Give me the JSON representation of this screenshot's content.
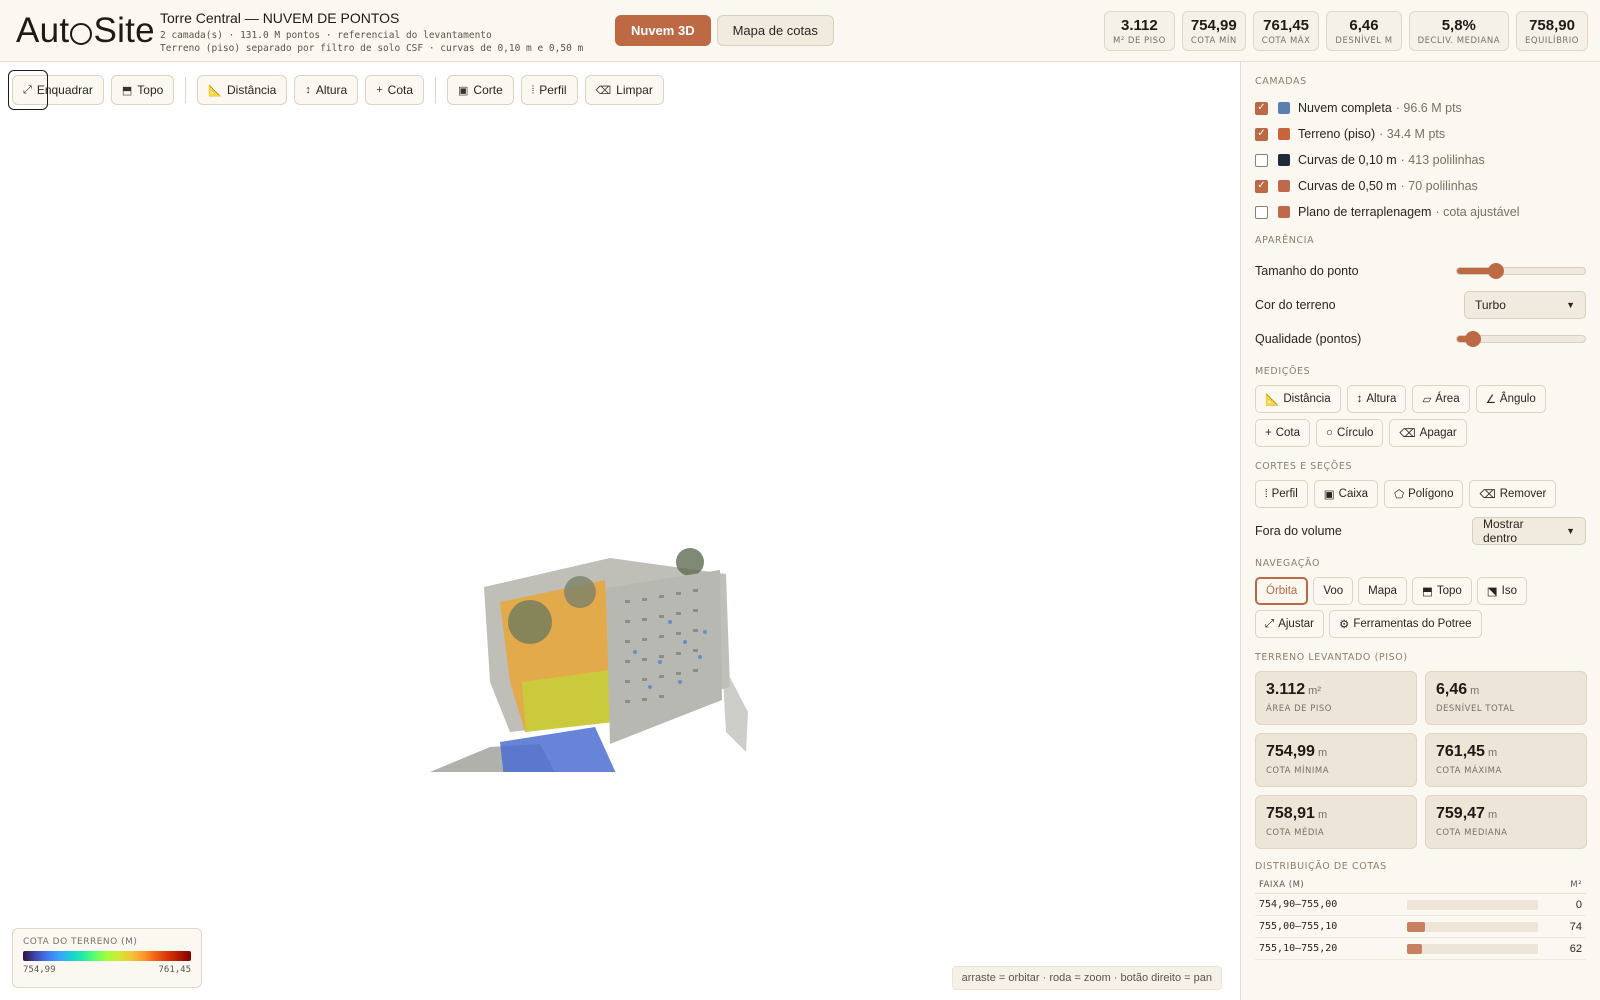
{
  "app": {
    "logo_left": "Aut",
    "logo_right": "Site",
    "project_title": "Torre Central — NUVEM DE PONTOS",
    "project_sub1": "2 camada(s) · 131.0 M pontos · referencial do levantamento",
    "project_sub2": "Terreno (piso) separado por filtro de solo CSF · curvas de 0,10 m e 0,50 m"
  },
  "mode_tabs": [
    {
      "label": "Nuvem 3D",
      "active": true
    },
    {
      "label": "Mapa de cotas",
      "active": false
    }
  ],
  "stats": [
    {
      "value": "3.112",
      "label": "M² DE PISO"
    },
    {
      "value": "754,99",
      "label": "COTA MÍN"
    },
    {
      "value": "761,45",
      "label": "COTA MÁX"
    },
    {
      "value": "6,46",
      "label": "DESNÍVEL M"
    },
    {
      "value": "5,8%",
      "label": "DECLIV. MEDIANA"
    },
    {
      "value": "758,90",
      "label": "EQUILÍBRIO"
    }
  ],
  "toolbar": {
    "frame": "Enquadrar",
    "top": "Topo",
    "distance": "Distância",
    "height": "Altura",
    "elevation": "Cota",
    "cut": "Corte",
    "profile": "Perfil",
    "clear": "Limpar"
  },
  "legend": {
    "title": "COTA DO TERRENO (M)",
    "min": "754,99",
    "max": "761,45"
  },
  "hint": "arraste = orbitar · roda = zoom · botão direito = pan",
  "panel": {
    "layers_title": "CAMADAS",
    "layers": [
      {
        "name": "Nuvem completa",
        "desc": "· 96.6 M pts",
        "checked": true,
        "color": "#5b7fae"
      },
      {
        "name": "Terreno (piso)",
        "desc": "· 34.4 M pts",
        "checked": true,
        "color": "#c8643a"
      },
      {
        "name": "Curvas de 0,10 m",
        "desc": "· 413 polilinhas",
        "checked": false,
        "color": "#1e2a3a"
      },
      {
        "name": "Curvas de 0,50 m",
        "desc": "· 70 polilinhas",
        "checked": true,
        "color": "#c0694a"
      },
      {
        "name": "Plano de terraplenagem",
        "desc": "· cota ajustável",
        "checked": false,
        "color": "#c0694a"
      }
    ],
    "appearance_title": "APARÊNCIA",
    "point_size_label": "Tamanho do ponto",
    "point_size_value": 0.3,
    "terrain_color_label": "Cor do terreno",
    "terrain_color_value": "Turbo",
    "quality_label": "Qualidade (pontos)",
    "quality_value": 0.12,
    "measure_title": "MEDIÇÕES",
    "measure": {
      "distance": "Distância",
      "height": "Altura",
      "area": "Área",
      "angle": "Ângulo",
      "elevation": "Cota",
      "circle": "Círculo",
      "erase": "Apagar"
    },
    "cuts_title": "CORTES E SEÇÕES",
    "cuts": {
      "profile": "Perfil",
      "box": "Caixa",
      "polygon": "Polígono",
      "remove": "Remover"
    },
    "outside_label": "Fora do volume",
    "outside_value": "Mostrar dentro",
    "nav_title": "NAVEGAÇÃO",
    "nav": {
      "orbit": "Órbita",
      "fly": "Voo",
      "map": "Mapa",
      "top": "Topo",
      "iso": "Iso",
      "fit": "Ajustar",
      "potree": "Ferramentas do Potree"
    },
    "terrain_title": "TERRENO LEVANTADO (PISO)",
    "terrain_cards": [
      {
        "value": "3.112",
        "unit": "m²",
        "label": "ÁREA DE PISO"
      },
      {
        "value": "6,46",
        "unit": "m",
        "label": "DESNÍVEL TOTAL"
      },
      {
        "value": "754,99",
        "unit": "m",
        "label": "COTA MÍNIMA"
      },
      {
        "value": "761,45",
        "unit": "m",
        "label": "COTA MÁXIMA"
      },
      {
        "value": "758,91",
        "unit": "m",
        "label": "COTA MÉDIA"
      },
      {
        "value": "759,47",
        "unit": "m",
        "label": "COTA MEDIANA"
      }
    ],
    "dist_title": "DISTRIBUIÇÃO DE COTAS",
    "dist_head_range": "FAIXA (M)",
    "dist_head_area": "M²",
    "dist_max": 525,
    "distribution": [
      {
        "range": "754,90–755,00",
        "value": 0
      },
      {
        "range": "755,00–755,10",
        "value": 74
      },
      {
        "range": "755,10–755,20",
        "value": 62
      }
    ]
  }
}
